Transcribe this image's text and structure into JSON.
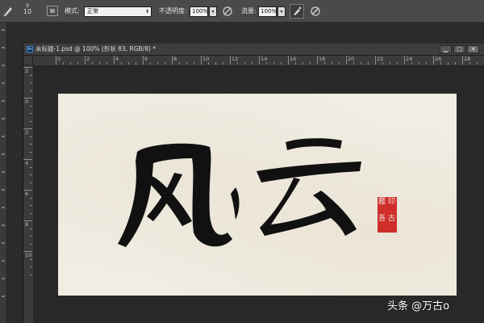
{
  "options_bar": {
    "brush_size": "9",
    "brush_size_alt": "10",
    "mode_label": "模式:",
    "mode_value": "正常",
    "opacity_label": "不透明度:",
    "opacity_value": "100%",
    "flow_label": "流量:",
    "flow_value": "100%",
    "dropdown_glyph": "▾"
  },
  "document": {
    "title": "未标题-1.psd @ 100% (形状 83, RGB/8) *",
    "ps_icon_text": "Ps",
    "buttons": {
      "minimize": "▁",
      "restore": "□",
      "close": "✕"
    }
  },
  "rulers": {
    "horizontal": [
      "0",
      "2",
      "4",
      "6",
      "8",
      "10",
      "12",
      "14",
      "16",
      "18",
      "20",
      "22",
      "24",
      "26",
      "28"
    ],
    "vertical": [
      "2",
      "0",
      "2",
      "4",
      "6",
      "8",
      "10"
    ]
  },
  "canvas": {
    "calligraphy_text": "风云",
    "seal_chars": [
      "鑑",
      "古",
      "吾",
      "印"
    ],
    "background_color": "#f1ede3",
    "seal_color": "#cf2e2b"
  },
  "watermark": "头条 @万古o",
  "icons": {
    "brush": "brush-icon",
    "preset": "brush-preset-icon",
    "pressure_opacity": "pressure-opacity-icon",
    "airbrush": "airbrush-icon",
    "pressure_size": "pressure-size-icon"
  }
}
